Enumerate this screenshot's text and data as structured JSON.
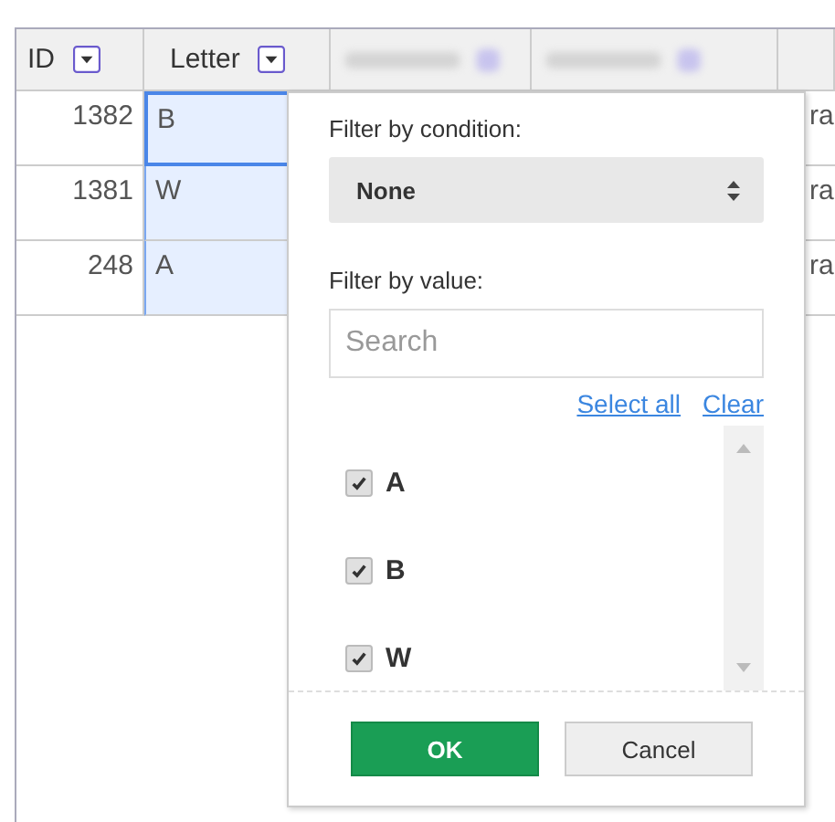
{
  "table": {
    "columns": [
      {
        "label": "ID",
        "selected": false
      },
      {
        "label": "Letter",
        "selected": true
      }
    ],
    "rows": [
      {
        "id": "1382",
        "letter": "B",
        "column_5": "ra",
        "active": true
      },
      {
        "id": "1381",
        "letter": "W",
        "column_5": "ra",
        "active": false
      },
      {
        "id": "248",
        "letter": "A",
        "column_5": "ra",
        "active": false
      }
    ]
  },
  "filter_menu": {
    "condition_label": "Filter by condition:",
    "condition_value": "None",
    "value_label": "Filter by value:",
    "search": {
      "placeholder": "Search"
    },
    "select_all": "Select all",
    "clear": "Clear",
    "values": [
      {
        "label": "A",
        "checked": true
      },
      {
        "label": "B",
        "checked": true
      },
      {
        "label": "W",
        "checked": true
      }
    ],
    "ok": "OK",
    "cancel": "Cancel"
  }
}
